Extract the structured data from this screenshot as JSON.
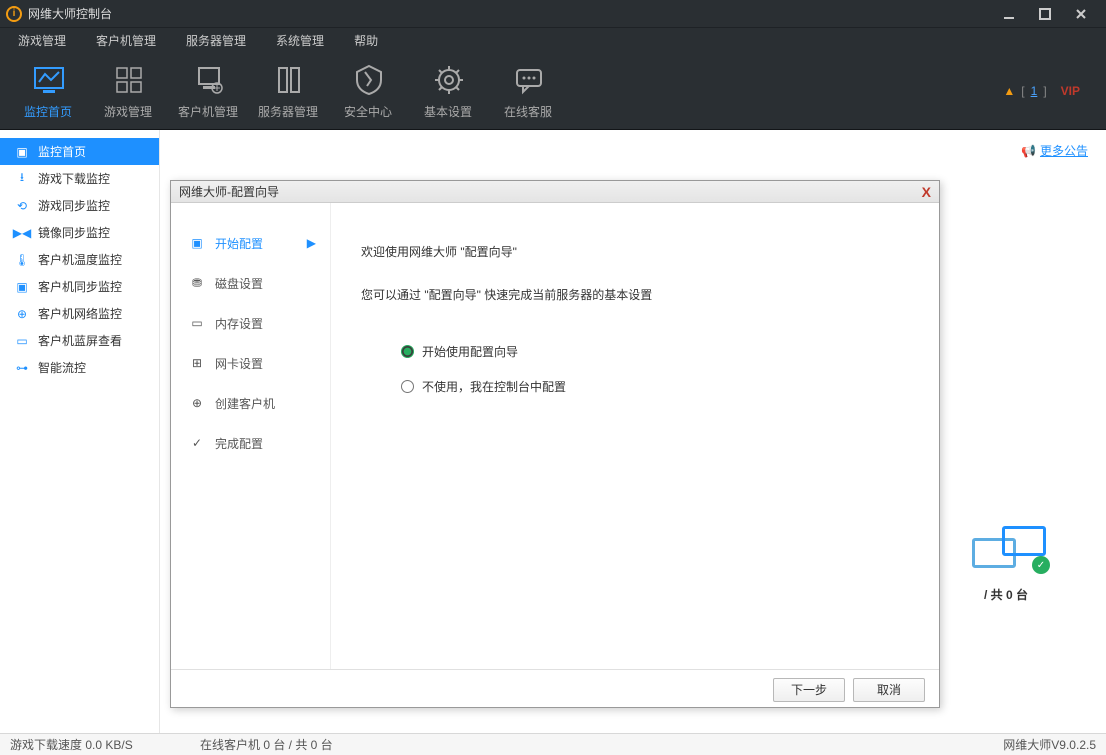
{
  "title": "网维大师控制台",
  "menu": [
    "游戏管理",
    "客户机管理",
    "服务器管理",
    "系统管理",
    "帮助"
  ],
  "toolbar": [
    {
      "label": "监控首页",
      "icon": "monitor"
    },
    {
      "label": "游戏管理",
      "icon": "game"
    },
    {
      "label": "客户机管理",
      "icon": "client"
    },
    {
      "label": "服务器管理",
      "icon": "server"
    },
    {
      "label": "安全中心",
      "icon": "shield"
    },
    {
      "label": "基本设置",
      "icon": "gear"
    },
    {
      "label": "在线客服",
      "icon": "chat"
    }
  ],
  "toolbar_status": {
    "count": "1",
    "vip": "VIP"
  },
  "sidebar": [
    "监控首页",
    "游戏下载监控",
    "游戏同步监控",
    "镜像同步监控",
    "客户机温度监控",
    "客户机同步监控",
    "客户机网络监控",
    "客户机蓝屏查看",
    "智能流控"
  ],
  "announce": "更多公告",
  "client_summary": "/ 共 0 台",
  "status": {
    "download": "游戏下载速度 0.0 KB/S",
    "online": "在线客户机 0 台 / 共 0 台",
    "version": "网维大师V9.0.2.5"
  },
  "dialog": {
    "title": "网维大师-配置向导",
    "nav": [
      "开始配置",
      "磁盘设置",
      "内存设置",
      "网卡设置",
      "创建客户机",
      "完成配置"
    ],
    "welcome1": "欢迎使用网维大师 \"配置向导\"",
    "welcome2": "您可以通过 \"配置向导\" 快速完成当前服务器的基本设置",
    "opt1": "开始使用配置向导",
    "opt2": "不使用，我在控制台中配置",
    "next": "下一步",
    "cancel": "取消"
  }
}
